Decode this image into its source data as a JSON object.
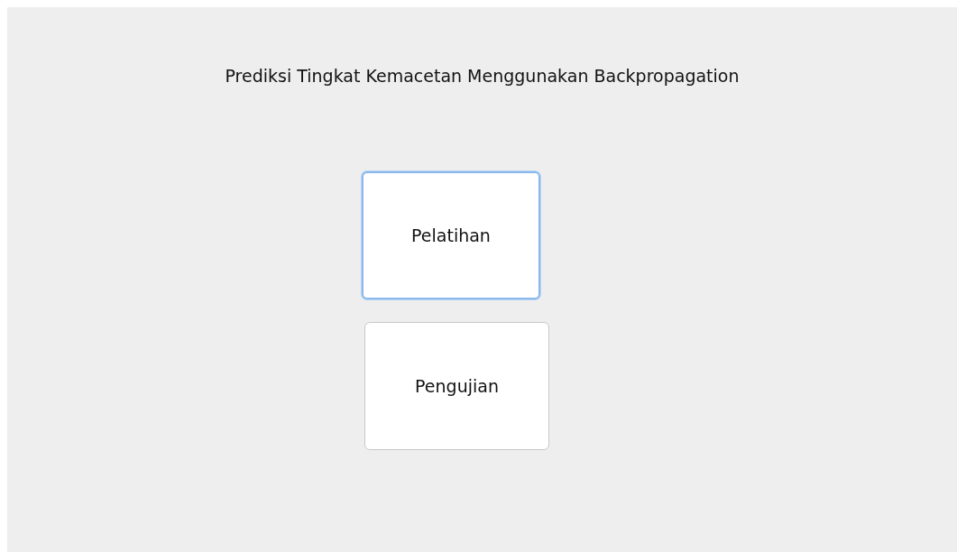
{
  "window": {
    "title": "Prediksi Tingkat Kemacetan Menggunakan Backpropagation"
  },
  "buttons": [
    {
      "label": "Pelatihan",
      "focused": true
    },
    {
      "label": "Pengujian",
      "focused": false
    }
  ]
}
